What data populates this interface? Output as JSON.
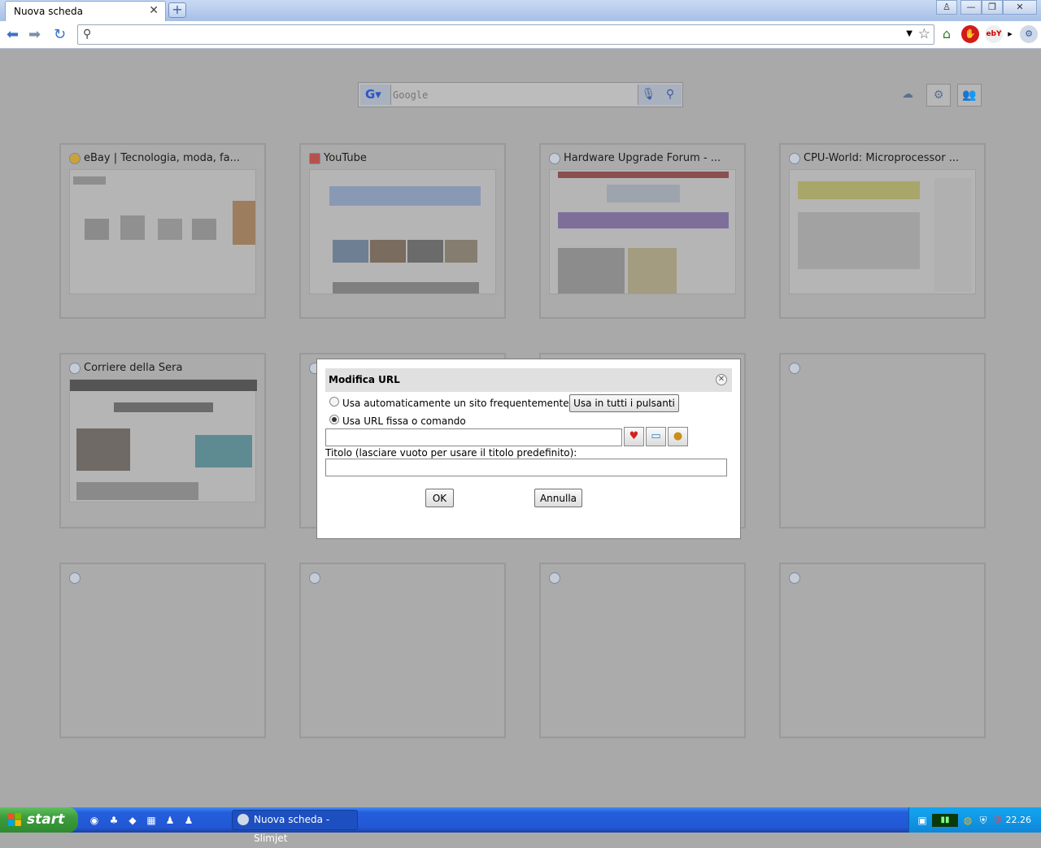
{
  "browser": {
    "tab_title": "Nuova scheda",
    "tab_close": "✕",
    "new_tab": "+",
    "window_controls": [
      "♙",
      "—",
      "❐",
      "✕"
    ],
    "omnibox_value": ""
  },
  "google_search": {
    "placeholder": "Google"
  },
  "tiles": [
    {
      "title": "eBay | Tecnologia, moda, fa..."
    },
    {
      "title": "YouTube"
    },
    {
      "title": "Hardware Upgrade Forum - ..."
    },
    {
      "title": "CPU-World: Microprocessor ..."
    },
    {
      "title": "Corriere della Sera"
    },
    {
      "title": ""
    },
    {
      "title": ""
    },
    {
      "title": ""
    },
    {
      "title": ""
    },
    {
      "title": ""
    },
    {
      "title": ""
    },
    {
      "title": ""
    }
  ],
  "dialog": {
    "title": "Modifica URL",
    "option_auto": "Usa automaticamente un sito frequentemente usato",
    "apply_all_label": "Usa in tutti i pulsanti",
    "option_fixed": "Usa URL fissa o comando",
    "url_value": "",
    "title_label": "Titolo (lasciare vuoto per usare il titolo predefinito):",
    "title_value": "",
    "ok_label": "OK",
    "cancel_label": "Annulla"
  },
  "taskbar": {
    "start_label": "start",
    "task_label": "Nuova scheda - Slimjet",
    "clock": "22.26"
  }
}
